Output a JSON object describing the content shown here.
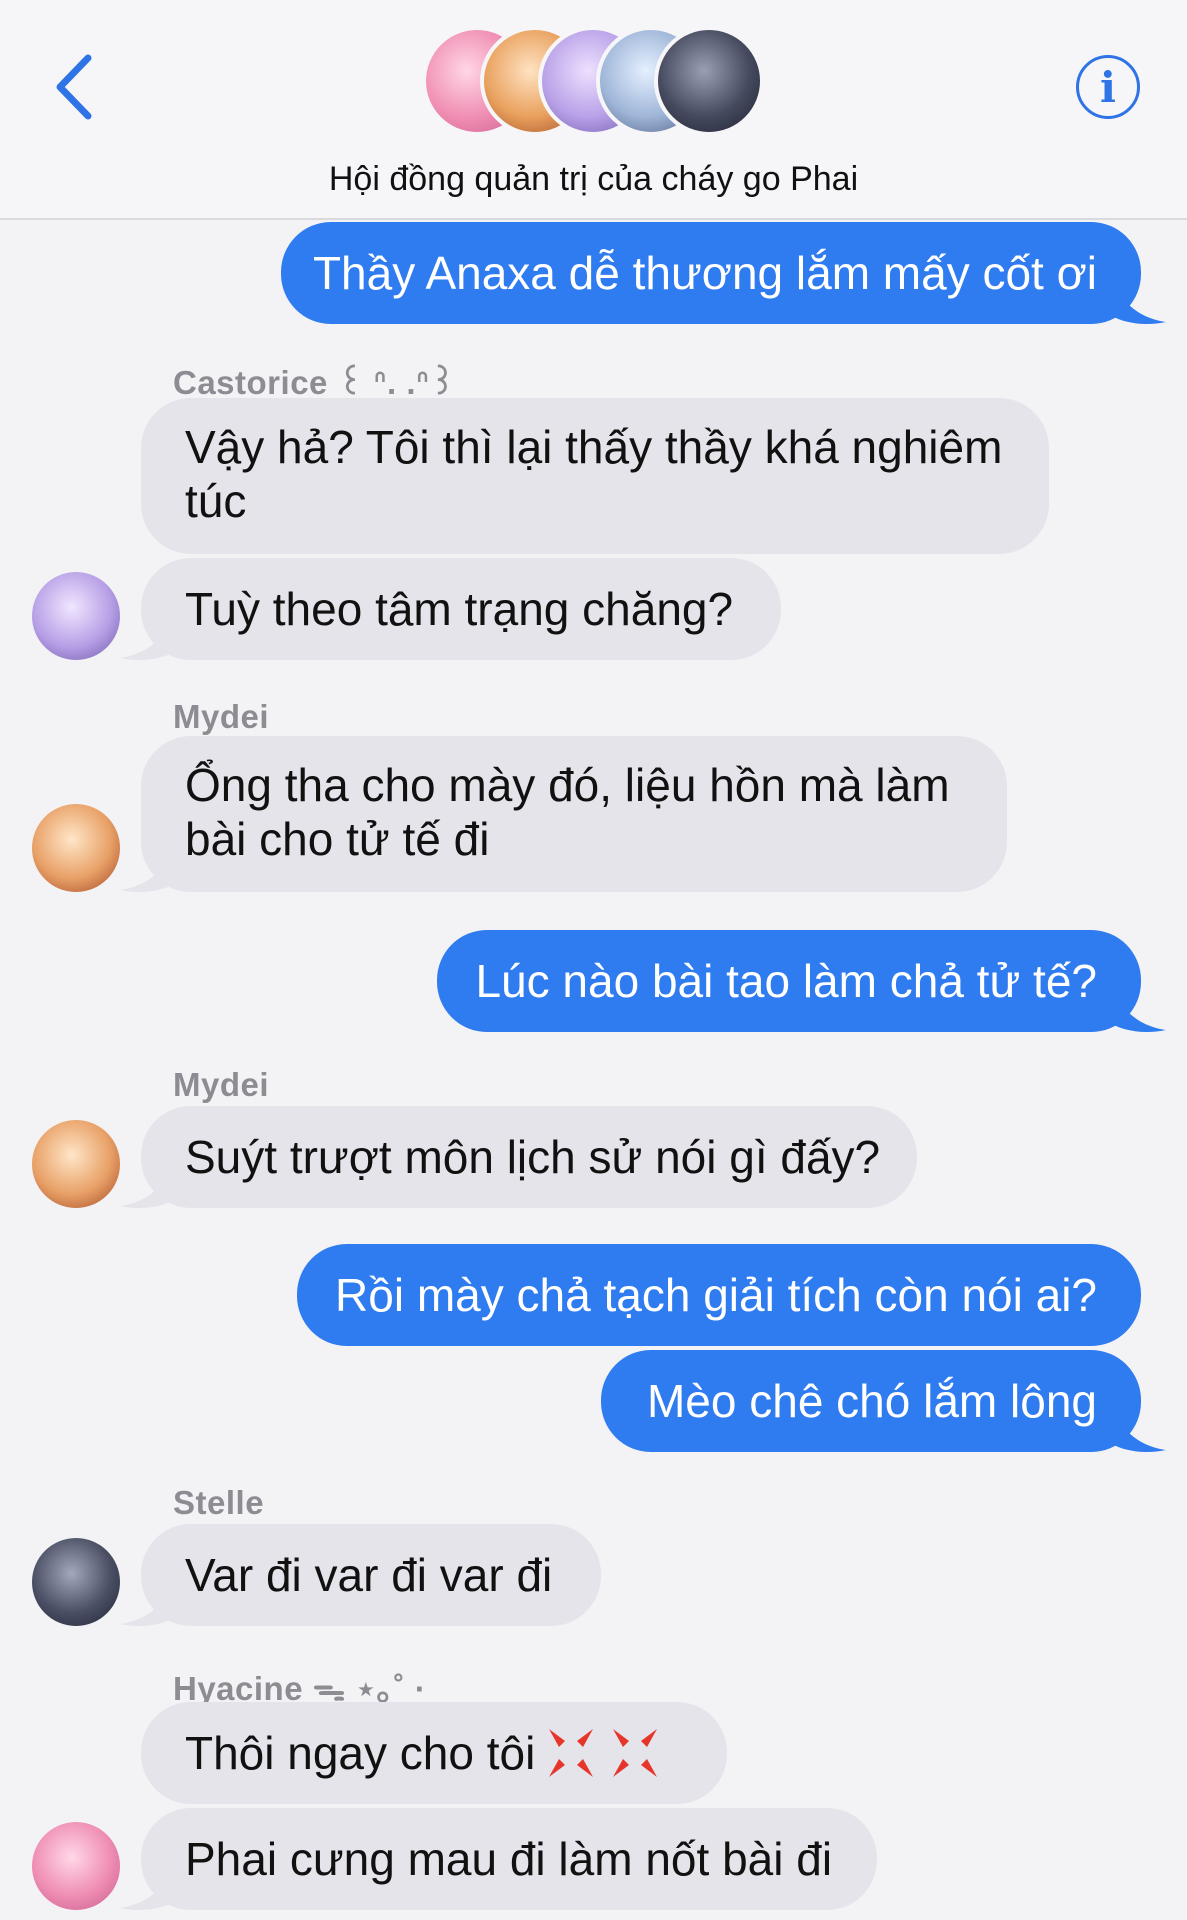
{
  "header": {
    "title": "Hội đồng quản trị của cháy go Phai",
    "back_icon": "chevron-left-icon",
    "info_icon": "info-icon",
    "info_glyph": "i",
    "accent": "#2f74e6"
  },
  "colors": {
    "outgoing_bubble": "#2f7bf0",
    "incoming_bubble": "#e4e4ea",
    "sender_name": "#8c8c92"
  },
  "messages": [
    {
      "side": "me",
      "text": "Thầy Anaxa dễ thương lắm mấy cốt ơi"
    },
    {
      "side": "them",
      "sender": "Castorice ꒰ ᐢ. .ᐢ꒱",
      "text": "Vậy hả? Tôi thì lại thấy thầy khá nghiêm túc"
    },
    {
      "side": "them",
      "text": "Tuỳ theo tâm trạng chăng?"
    },
    {
      "side": "them",
      "sender": "Mydei",
      "text": "Ổng tha cho mày đó, liệu hồn mà làm bài cho tử tế đi"
    },
    {
      "side": "me",
      "text": "Lúc nào bài tao làm chả tử tế?"
    },
    {
      "side": "them",
      "sender": "Mydei",
      "text": "Suýt trượt môn lịch sử nói gì đấy?"
    },
    {
      "side": "me",
      "text": "Rồi mày chả tạch giải tích còn nói ai?"
    },
    {
      "side": "me",
      "text": "Mèo chê chó lắm lông"
    },
    {
      "side": "them",
      "sender": "Stelle",
      "text": "Var đi var đi var đi"
    },
    {
      "side": "them",
      "sender": "Hyacine ᯓ ⋆｡˚ ·",
      "text": "Thôi ngay cho tôi",
      "emoji": "anger-symbol-icon"
    },
    {
      "side": "them",
      "text": "Phai cưng mau đi làm nốt bài đi"
    }
  ]
}
